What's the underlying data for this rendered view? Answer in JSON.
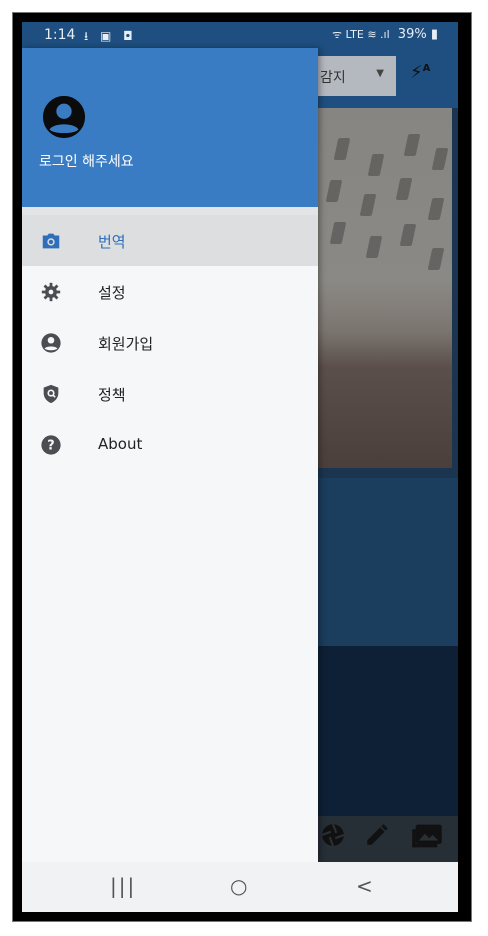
{
  "status_bar": {
    "time": "1:14",
    "left_icons": "⭳ ▣ ◘",
    "signal": "ᯤ LTE ≋ .ıl",
    "battery": "39%"
  },
  "background_app": {
    "language_select": "감지",
    "flash_icon": "flash-auto-icon",
    "bottom_icons": [
      "shutter-icon",
      "pencil-icon",
      "gallery-icon"
    ]
  },
  "drawer": {
    "login_text": "로그인 해주세요",
    "items": [
      {
        "label": "번역",
        "icon": "camera-icon",
        "active": true
      },
      {
        "label": "설정",
        "icon": "gear-icon",
        "active": false
      },
      {
        "label": "회원가입",
        "icon": "account-circle-icon",
        "active": false
      },
      {
        "label": "정책",
        "icon": "shield-icon",
        "active": false
      },
      {
        "label": "About",
        "icon": "help-icon",
        "active": false
      }
    ]
  },
  "nav_bar": {
    "recents": "|||",
    "home": "○",
    "back": "<"
  },
  "colors": {
    "header_blue": "#3a7cc4",
    "status_blue": "#1e4f80",
    "active_text": "#2f6fb8",
    "icon_gray": "#4a4d52"
  }
}
